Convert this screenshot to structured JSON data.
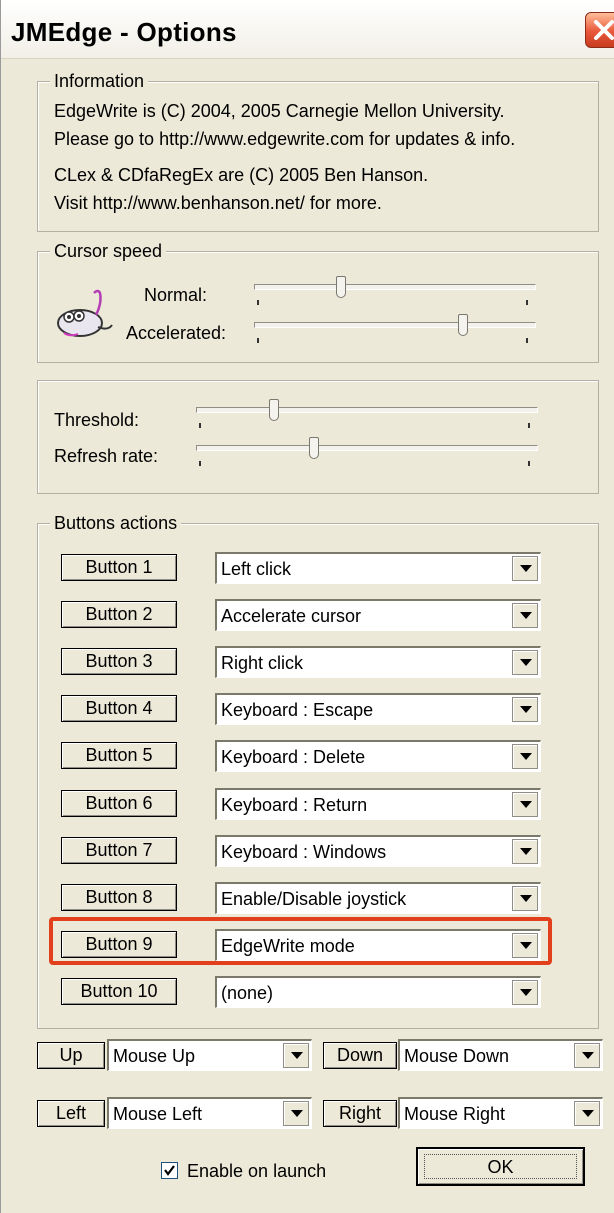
{
  "window": {
    "title": "JMEdge - Options"
  },
  "information": {
    "legend": "Information",
    "lines": [
      "EdgeWrite is (C) 2004, 2005 Carnegie Mellon University.",
      "Please go to http://www.edgewrite.com for updates & info.",
      "CLex & CDfaRegEx are (C) 2005 Ben Hanson.",
      "Visit http://www.benhanson.net/ for more."
    ]
  },
  "cursor_speed": {
    "legend": "Cursor speed",
    "normal_label": "Normal:",
    "accelerated_label": "Accelerated:",
    "normal_value": 0.3,
    "accelerated_value": 0.75
  },
  "thresholds": {
    "threshold_label": "Threshold:",
    "refresh_label": "Refresh rate:",
    "threshold_value": 0.22,
    "refresh_value": 0.34
  },
  "buttons_actions": {
    "legend": "Buttons actions",
    "rows": [
      {
        "button": "Button 1",
        "action": "Left click"
      },
      {
        "button": "Button 2",
        "action": "Accelerate cursor"
      },
      {
        "button": "Button 3",
        "action": "Right click"
      },
      {
        "button": "Button 4",
        "action": "Keyboard : Escape"
      },
      {
        "button": "Button 5",
        "action": "Keyboard : Delete"
      },
      {
        "button": "Button 6",
        "action": "Keyboard : Return"
      },
      {
        "button": "Button 7",
        "action": "Keyboard : Windows"
      },
      {
        "button": "Button 8",
        "action": "Enable/Disable joystick"
      },
      {
        "button": "Button 9",
        "action": "EdgeWrite mode"
      },
      {
        "button": "Button 10",
        "action": "(none)"
      }
    ]
  },
  "directions": {
    "up": {
      "label": "Up",
      "value": "Mouse Up"
    },
    "down": {
      "label": "Down",
      "value": "Mouse Down"
    },
    "left": {
      "label": "Left",
      "value": "Mouse Left"
    },
    "right": {
      "label": "Right",
      "value": "Mouse Right"
    }
  },
  "footer": {
    "enable_label": "Enable on launch",
    "enable_checked": true,
    "ok_label": "OK"
  },
  "colors": {
    "highlight": "#E2401C",
    "window_bg": "#ECE9D8"
  }
}
